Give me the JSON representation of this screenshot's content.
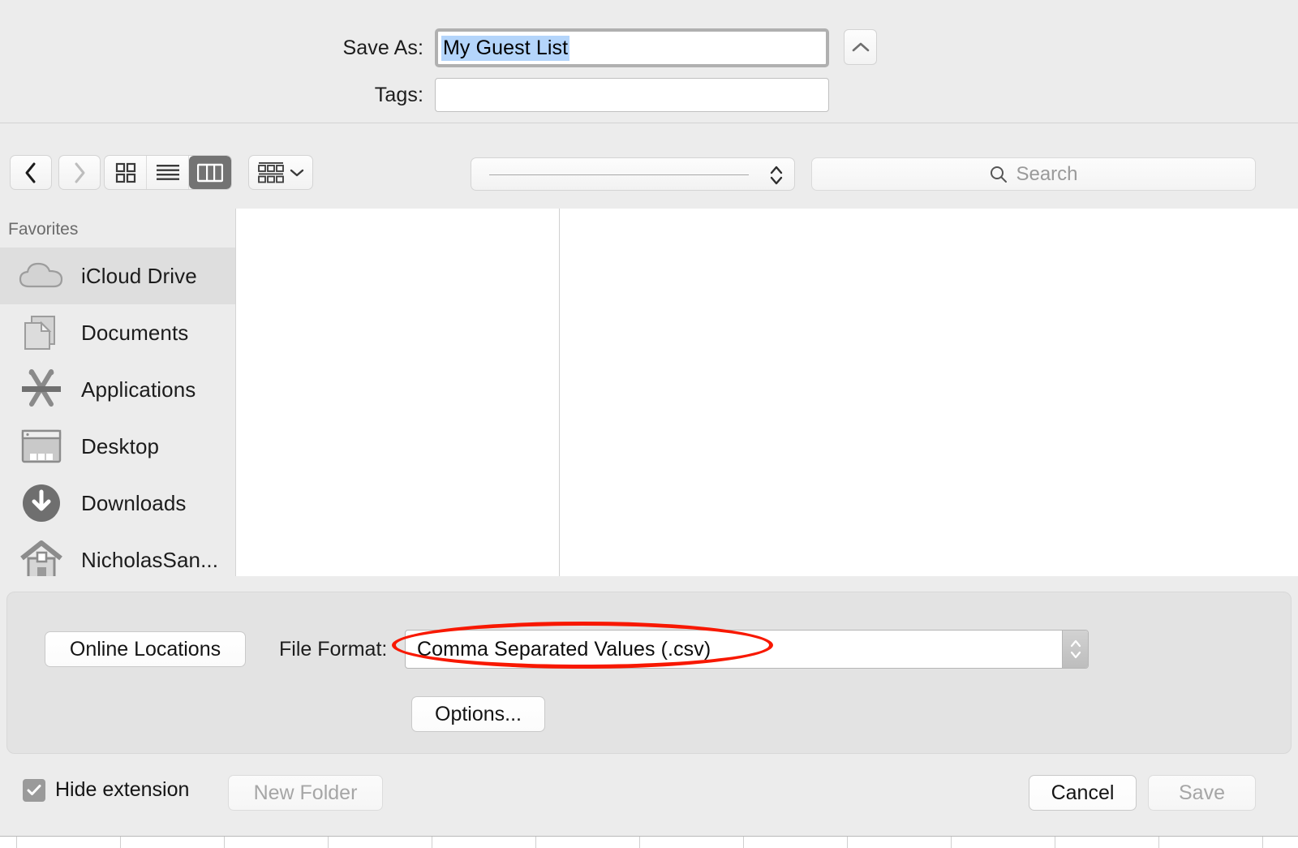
{
  "dialog": {
    "save_as_label": "Save As:",
    "save_as_value": "My Guest List",
    "tags_label": "Tags:",
    "tags_value": "",
    "expand_button_icon": "chevron-up-icon"
  },
  "toolbar": {
    "back_icon": "chevron-left-icon",
    "forward_icon": "chevron-right-icon",
    "view_icon_grid": "grid-view-icon",
    "view_icon_list": "list-view-icon",
    "view_icon_column": "column-view-icon",
    "active_view": "column",
    "group_icon": "group-by-icon",
    "group_chevron_icon": "chevron-down-icon",
    "path_value": "",
    "search_placeholder": "Search",
    "search_icon": "search-icon"
  },
  "sidebar": {
    "header": "Favorites",
    "selected": "iCloud Drive",
    "items": [
      {
        "label": "iCloud Drive",
        "icon": "cloud-icon"
      },
      {
        "label": "Documents",
        "icon": "documents-icon"
      },
      {
        "label": "Applications",
        "icon": "applications-icon"
      },
      {
        "label": "Desktop",
        "icon": "desktop-icon"
      },
      {
        "label": "Downloads",
        "icon": "downloads-icon"
      },
      {
        "label": "NicholasSan...",
        "icon": "home-icon"
      }
    ]
  },
  "options": {
    "online_locations_label": "Online Locations",
    "file_format_label": "File Format:",
    "file_format_value": "Comma Separated Values (.csv)",
    "options_button_label": "Options...",
    "stepper_icon": "stepper-arrows-icon"
  },
  "footer": {
    "hide_extension_label": "Hide extension",
    "hide_extension_checked": true,
    "check_icon": "checkmark-icon",
    "new_folder_label": "New Folder",
    "new_folder_enabled": false,
    "cancel_label": "Cancel",
    "save_label": "Save",
    "save_enabled": false
  },
  "annotation": {
    "type": "ellipse-highlight",
    "color": "#f81800",
    "target": "file_format_value"
  },
  "colors": {
    "window_bg": "#ececec",
    "panel_bg": "#e3e3e3",
    "selection_blue": "#b4d5fb",
    "sidebar_selected": "#dedede",
    "annotation_red": "#f81800"
  }
}
